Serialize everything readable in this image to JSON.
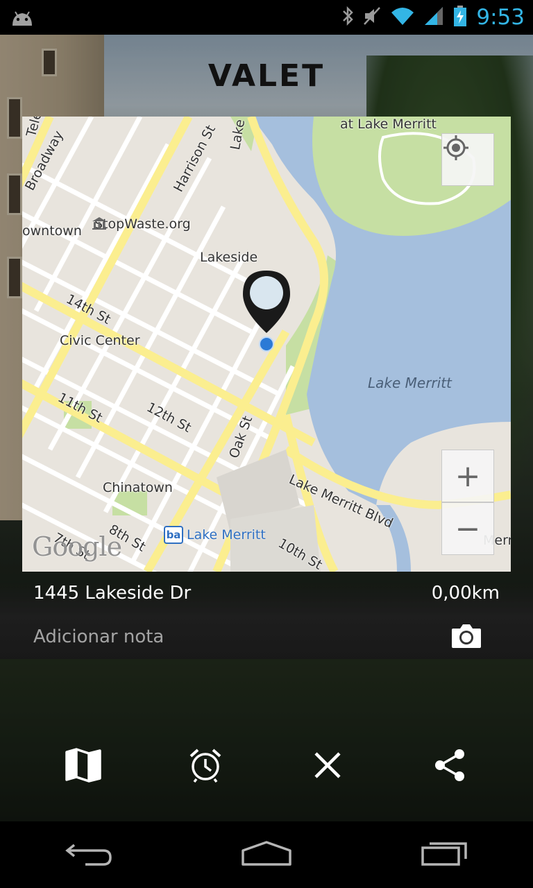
{
  "status_bar": {
    "time": "9:53",
    "icons": [
      "android-icon",
      "bluetooth-icon",
      "mute-icon",
      "wifi-icon",
      "signal-icon",
      "battery-charging-icon"
    ],
    "time_color": "#33b5e5"
  },
  "app": {
    "title": "VALET"
  },
  "map": {
    "labels": {
      "at_lake_merritt": "at Lake Merritt",
      "telegraph": "Telegr",
      "broadway": "Broadway",
      "harrison": "Harrison St",
      "lake": "Lake",
      "downtown": "owntown",
      "stopwaste": "StopWaste.org",
      "lakeside": "Lakeside",
      "st14": "14th St",
      "civic_center": "Civic Center",
      "lake_merritt_water": "Lake Merritt",
      "st11": "11th St",
      "st12": "12th St",
      "oak": "Oak St",
      "chinatown": "Chinatown",
      "lake_merritt_blvd": "Lake Merritt Blvd",
      "st7": "7th St",
      "st8": "8th St",
      "st10": "10th St",
      "bart_station": "Lake Merritt",
      "merr": "Merri"
    },
    "bart_badge": "ba",
    "google": "Google",
    "zoom_in": "+",
    "zoom_out": "−",
    "colors": {
      "land": "#e8e4dd",
      "road_major": "#fbee8f",
      "water": "#a5bfdd",
      "park": "#c6dfa3"
    }
  },
  "details": {
    "address": "1445 Lakeside Dr",
    "distance": "0,00km",
    "note_placeholder": "Adicionar nota"
  },
  "actions": [
    {
      "name": "map-button",
      "icon": "map-icon"
    },
    {
      "name": "alarm-button",
      "icon": "alarm-icon"
    },
    {
      "name": "close-button",
      "icon": "close-icon"
    },
    {
      "name": "share-button",
      "icon": "share-icon"
    }
  ],
  "nav": [
    "back-icon",
    "home-icon",
    "recent-apps-icon"
  ]
}
